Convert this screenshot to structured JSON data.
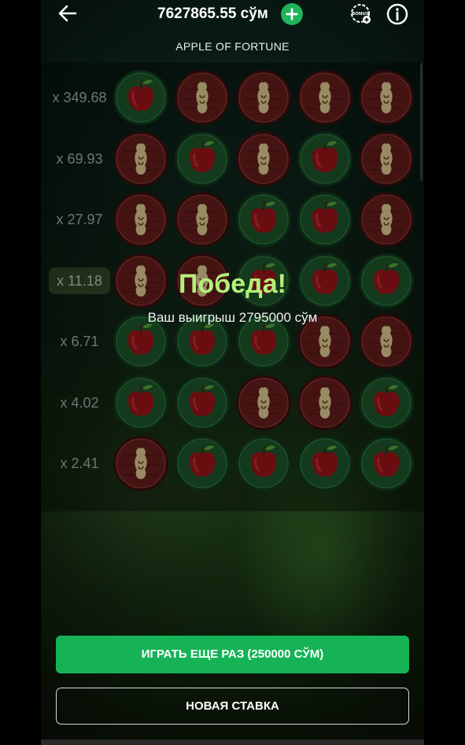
{
  "header": {
    "balance": "7627865.55 сўм",
    "game_title": "APPLE OF FORTUNE",
    "icons": {
      "back": "arrow-left-icon",
      "add": "plus-icon",
      "bonus": "bonus-icon",
      "info": "info-icon"
    }
  },
  "grid": {
    "rows": [
      {
        "multiplier": "x 349.68",
        "active": false,
        "tiles": [
          "apple",
          "core",
          "core",
          "core",
          "core"
        ]
      },
      {
        "multiplier": "x 69.93",
        "active": false,
        "tiles": [
          "core",
          "apple",
          "core",
          "apple",
          "core"
        ]
      },
      {
        "multiplier": "x 27.97",
        "active": false,
        "tiles": [
          "core",
          "core",
          "apple",
          "apple",
          "core"
        ]
      },
      {
        "multiplier": "x 11.18",
        "active": true,
        "tiles": [
          "core",
          "core",
          "apple",
          "apple",
          "apple"
        ]
      },
      {
        "multiplier": "x 6.71",
        "active": false,
        "tiles": [
          "apple",
          "apple",
          "apple",
          "core",
          "core"
        ]
      },
      {
        "multiplier": "x 4.02",
        "active": false,
        "tiles": [
          "apple",
          "apple",
          "core",
          "core",
          "apple"
        ]
      },
      {
        "multiplier": "x 2.41",
        "active": false,
        "tiles": [
          "core",
          "apple",
          "apple",
          "apple",
          "apple"
        ]
      }
    ]
  },
  "win": {
    "title": "Победа!",
    "message": "Ваш выигрыш 2795000 сўм"
  },
  "actions": {
    "play_again_label": "ИГРАТЬ ЕЩЕ РАЗ (250000 СЎМ)",
    "new_bet_label": "НОВАЯ СТАВКА"
  },
  "colors": {
    "accent_green": "#16b356",
    "win_green": "#b3f07a",
    "apple_tile": "#1e5a2c",
    "core_tile": "#6a1f1c"
  }
}
